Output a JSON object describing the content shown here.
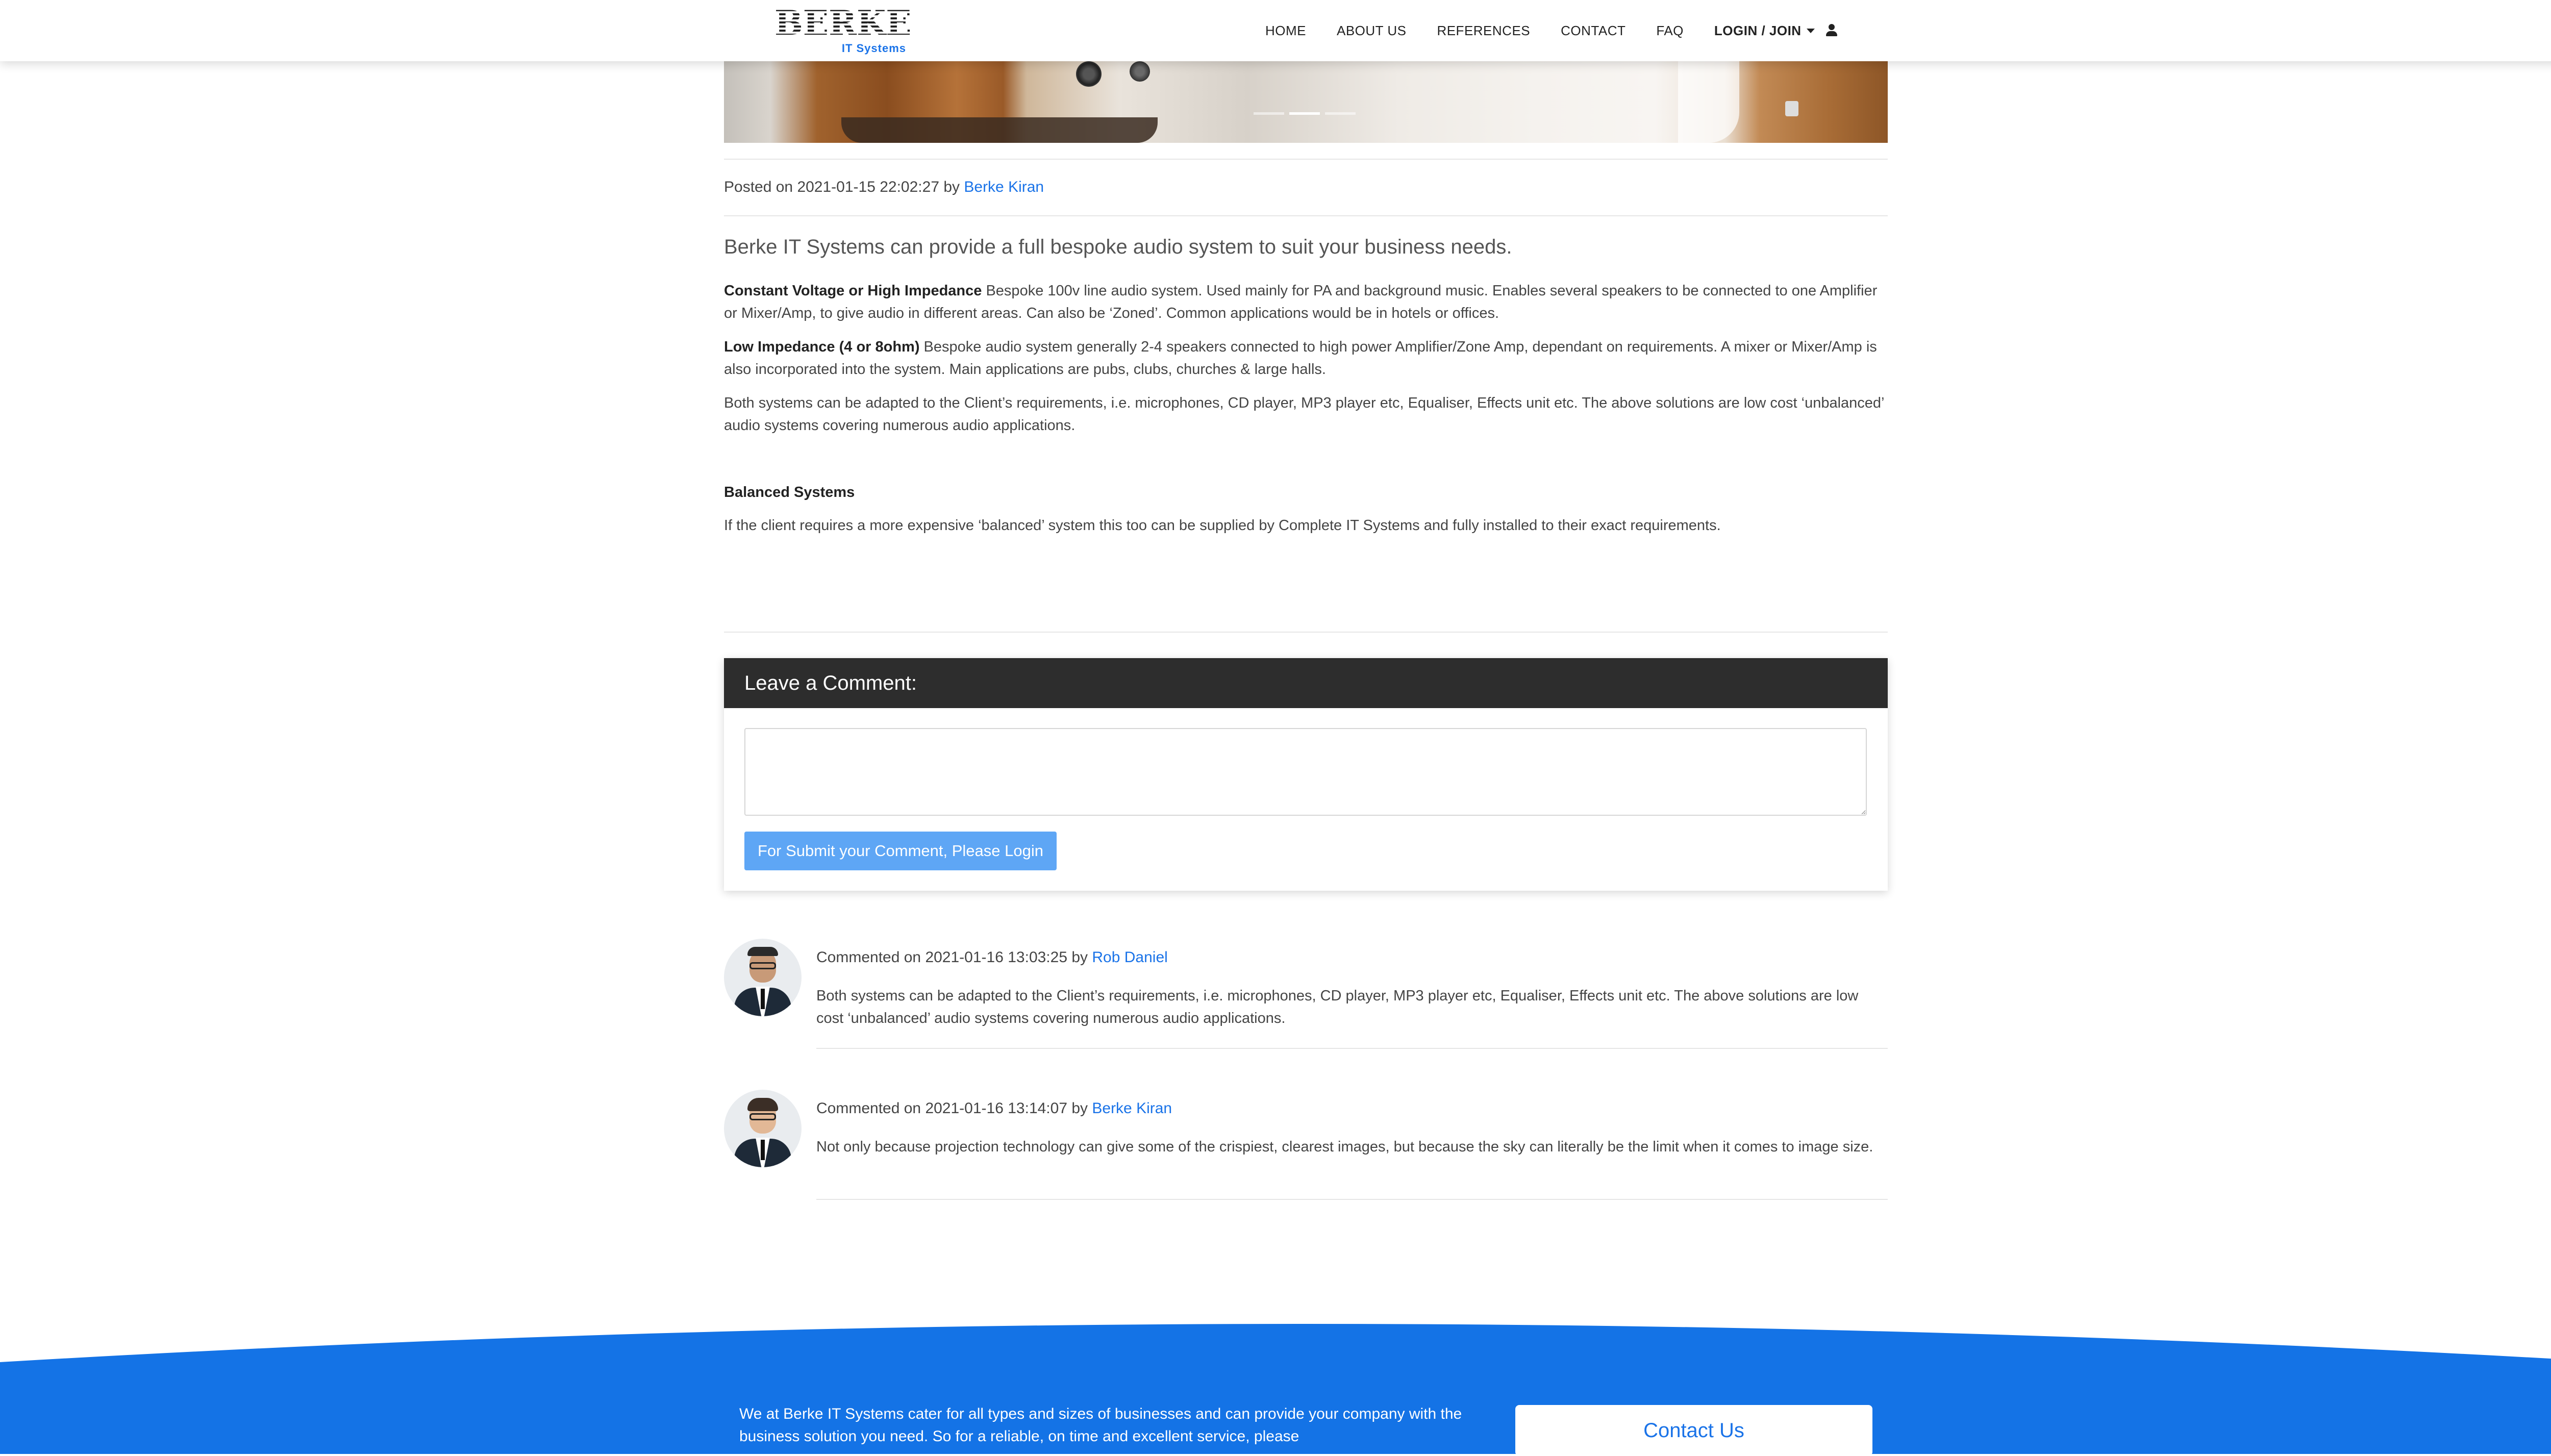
{
  "header": {
    "logo_text": "BERKE",
    "logo_subtitle": "IT Systems",
    "nav": [
      "HOME",
      "ABOUT US",
      "REFERENCES",
      "CONTACT",
      "FAQ"
    ],
    "login_label": "LOGIN / JOIN"
  },
  "post": {
    "posted_prefix": "Posted on 2021-01-15 22:02:27 by",
    "author": "Berke Kiran",
    "lead": "Berke IT Systems can provide a full bespoke audio system to suit your business needs.",
    "p1_title": "Constant Voltage or High Impedance",
    "p1_text": " Bespoke 100v line audio system. Used mainly for PA and background music. Enables several speakers to be connected to one Amplifier or Mixer/Amp, to give audio in different areas. Can also be ‘Zoned’. Common applications would be in hotels or offices.",
    "p2_title": "Low Impedance (4 or 8ohm)",
    "p2_text": " Bespoke audio system generally 2-4 speakers connected to high power Amplifier/Zone Amp, dependant on requirements. A mixer or Mixer/Amp is also incorporated into the system. Main applications are pubs, clubs, churches & large halls.",
    "p3_text": "Both systems can be adapted to the Client’s requirements, i.e. microphones, CD player, MP3 player etc, Equaliser, Effects unit etc.  The above solutions are low cost ‘unbalanced’ audio systems covering numerous audio applications.",
    "p4_title": "Balanced Systems",
    "p5_text": "If the client requires a more expensive ‘balanced’ system this too can be supplied by Complete IT Systems and fully installed to their exact requirements."
  },
  "comment_form": {
    "title": "Leave a Comment:",
    "submit_label": "For Submit your Comment, Please Login"
  },
  "comments": [
    {
      "meta": "Commented on 2021-01-16 13:03:25 by",
      "author": "Rob Daniel",
      "text": "Both systems can be adapted to the Client’s requirements, i.e. microphones, CD player, MP3 player etc, Equaliser, Effects unit etc. The above solutions are low cost ‘unbalanced’ audio systems covering numerous audio applications."
    },
    {
      "meta": "Commented on 2021-01-16 13:14:07 by",
      "author": "Berke Kiran",
      "text": "Not only because projection technology can give some of the crispiest, clearest images, but because the sky can literally be the limit when it comes to image size."
    }
  ],
  "footer": {
    "text": "We at Berke IT Systems cater for all types and sizes of businesses and can provide your company with the business solution you need. So for a reliable, on time and excellent service, please",
    "contact_label": "Contact Us"
  },
  "colors": {
    "accent": "#1a73e8",
    "footer_bg": "#1473e6",
    "card_header": "#2d2d2d",
    "button_bg": "#5ea6f5"
  }
}
